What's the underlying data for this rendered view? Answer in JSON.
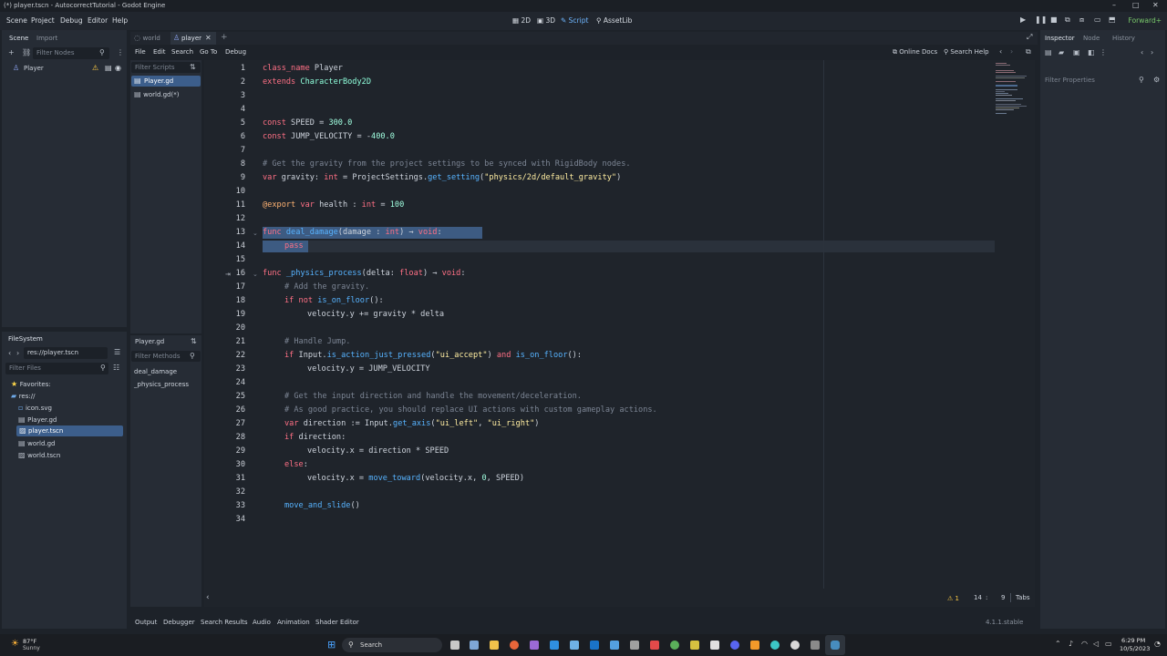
{
  "window": {
    "title": "(*) player.tscn - AutocorrectTutorial - Godot Engine",
    "min": "–",
    "max": "□",
    "close": "✕"
  },
  "menu": [
    "Scene",
    "Project",
    "Debug",
    "Editor",
    "Help"
  ],
  "workspaces": [
    "2D",
    "3D",
    "Script",
    "AssetLib"
  ],
  "renderer": "Forward+",
  "scene_dock": {
    "tabs": [
      "Scene",
      "Import"
    ],
    "filter_placeholder": "Filter Nodes",
    "root_node": "Player"
  },
  "filesystem": {
    "tab": "FileSystem",
    "path": "res://player.tscn",
    "filter_placeholder": "Filter Files",
    "favorites": "Favorites:",
    "root": "res://",
    "files": [
      "icon.svg",
      "Player.gd",
      "player.tscn",
      "world.gd",
      "world.tscn"
    ]
  },
  "editor_tabs": [
    "world",
    "player"
  ],
  "script_menu": [
    "File",
    "Edit",
    "Search",
    "Go To",
    "Debug"
  ],
  "script_tools": [
    "Online Docs",
    "Search Help"
  ],
  "script_list": {
    "filter_placeholder": "Filter Scripts",
    "items": [
      "Player.gd",
      "world.gd(*)"
    ],
    "current": "Player.gd",
    "methods_filter": "Filter Methods",
    "methods": [
      "deal_damage",
      "_physics_process"
    ]
  },
  "code_lines": [
    "1",
    "2",
    "3",
    "4",
    "5",
    "6",
    "7",
    "8",
    "9",
    "10",
    "11",
    "12",
    "13",
    "14",
    "15",
    "16",
    "17",
    "18",
    "19",
    "20",
    "21",
    "22",
    "23",
    "24",
    "25",
    "26",
    "27",
    "28",
    "29",
    "30",
    "31",
    "32",
    "33",
    "34"
  ],
  "code": {
    "l1a": "class_name",
    "l1b": " Player",
    "l2a": "extends",
    "l2b": " CharacterBody2D",
    "l5a": "const",
    "l5b": " SPEED = ",
    "l5c": "300.0",
    "l6a": "const",
    "l6b": " JUMP_VELOCITY = -",
    "l6c": "400.0",
    "l8": "# Get the gravity from the project settings to be synced with RigidBody nodes.",
    "l9a": "var",
    "l9b": " gravity: ",
    "l9c": "int",
    "l9d": " = ProjectSettings.",
    "l9e": "get_setting",
    "l9f": "(",
    "l9g": "\"physics/2d/default_gravity\"",
    "l9h": ")",
    "l11a": "@export",
    "l11b": " var",
    "l11c": " health : ",
    "l11d": "int",
    "l11e": " = ",
    "l11f": "100",
    "l13a": "func",
    "l13b": " deal_damage",
    "l13c": "(damage : ",
    "l13d": "int",
    "l13e": ") → ",
    "l13f": "void",
    "l13g": ":",
    "l14": "pass",
    "l16a": "func",
    "l16b": " _physics_process",
    "l16c": "(delta: ",
    "l16d": "float",
    "l16e": ") → ",
    "l16f": "void",
    "l16g": ":",
    "l17": "# Add the gravity.",
    "l18a": "if",
    "l18b": " not",
    "l18c": " is_on_floor",
    "l18d": "():",
    "l19": "velocity.y += gravity * delta",
    "l21": "# Handle Jump.",
    "l22a": "if",
    "l22b": " Input.",
    "l22c": "is_action_just_pressed",
    "l22d": "(",
    "l22e": "\"ui_accept\"",
    "l22f": ") ",
    "l22g": "and",
    "l22h": " is_on_floor",
    "l22i": "():",
    "l23": "velocity.y = JUMP_VELOCITY",
    "l25": "# Get the input direction and handle the movement/deceleration.",
    "l26": "# As good practice, you should replace UI actions with custom gameplay actions.",
    "l27a": "var",
    "l27b": " direction := Input.",
    "l27c": "get_axis",
    "l27d": "(",
    "l27e": "\"ui_left\"",
    "l27f": ", ",
    "l27g": "\"ui_right\"",
    "l27h": ")",
    "l28a": "if",
    "l28b": " direction:",
    "l29": "velocity.x = direction * SPEED",
    "l30a": "else",
    "l30b": ":",
    "l31a": "velocity.x = ",
    "l31b": "move_toward",
    "l31c": "(velocity.x, ",
    "l31d": "0",
    "l31e": ", SPEED)",
    "l33a": "move_and_slide",
    "l33b": "()"
  },
  "status": {
    "warnings": "1",
    "line": "14",
    "col": "9",
    "indent": "Tabs"
  },
  "bottom_tabs": [
    "Output",
    "Debugger",
    "Search Results",
    "Audio",
    "Animation",
    "Shader Editor"
  ],
  "version": "4.1.1.stable",
  "inspector": {
    "tabs": [
      "Inspector",
      "Node",
      "History"
    ],
    "filter_placeholder": "Filter Properties"
  },
  "taskbar": {
    "temp": "87°F",
    "weather": "Sunny",
    "search": "Search",
    "time": "6:29 PM",
    "date": "10/5/2023"
  }
}
